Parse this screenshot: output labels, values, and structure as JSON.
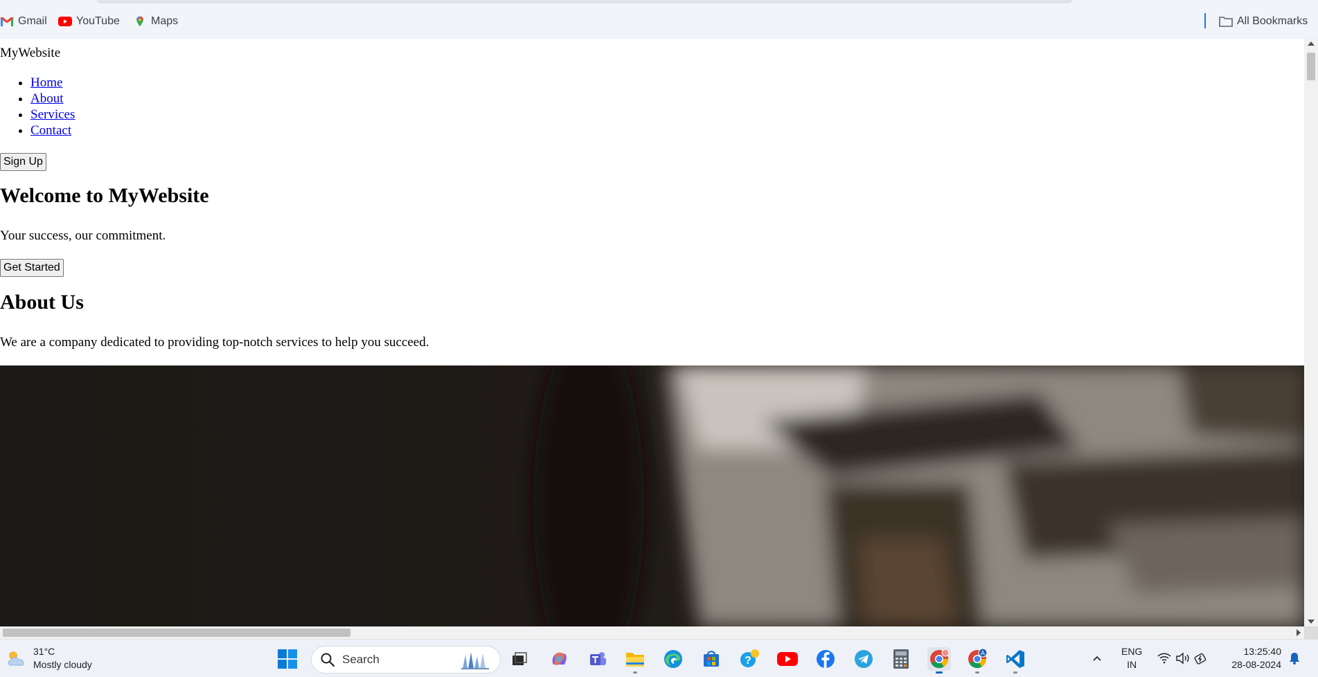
{
  "bookmarks": {
    "items": [
      {
        "label": "Gmail",
        "icon": "gmail-icon"
      },
      {
        "label": "YouTube",
        "icon": "youtube-icon"
      },
      {
        "label": "Maps",
        "icon": "maps-icon"
      }
    ],
    "all_label": "All Bookmarks",
    "all_icon": "folder-icon"
  },
  "page": {
    "logo": "MyWebsite",
    "nav": [
      "Home",
      "About",
      "Services",
      "Contact"
    ],
    "signup_label": "Sign Up",
    "hero_title": "Welcome to MyWebsite",
    "hero_tagline": "Your success, our commitment.",
    "cta_label": "Get Started",
    "about_title": "About Us",
    "about_text": "We are a company dedicated to providing top-notch services to help you succeed."
  },
  "taskbar": {
    "weather": {
      "temp": "31°C",
      "condition": "Mostly cloudy",
      "icon": "cloud-sun-icon"
    },
    "search_label": "Search",
    "apps": [
      "task-view-icon",
      "copilot-icon",
      "teams-icon",
      "file-explorer-icon",
      "edge-icon",
      "store-icon",
      "help-icon",
      "youtube-icon",
      "facebook-icon",
      "telegram-icon",
      "calculator-icon",
      "chrome-icon",
      "chrome-profile-icon",
      "vscode-icon"
    ],
    "language": {
      "line1": "ENG",
      "line2": "IN"
    },
    "clock": {
      "time": "13:25:40",
      "date": "28-08-2024"
    }
  },
  "colors": {
    "link": "#0000ee",
    "bookmark_bar_bg": "#f1f4f9",
    "taskbar_bg": "#eef1f7",
    "accent": "#1a73e8"
  }
}
